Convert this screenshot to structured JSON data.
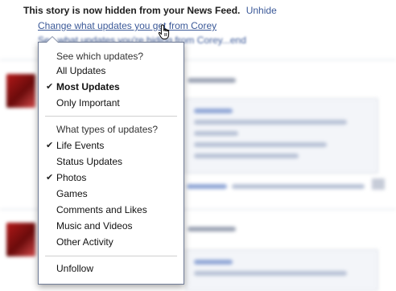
{
  "notice": {
    "text": "This story is now hidden from your News Feed.",
    "unhide_label": "Unhide"
  },
  "change_link": "Change what updates you get from Corey",
  "hidden_link": "See what updates you're hiding from Corey...end",
  "menu": {
    "section1_heading": "See which updates?",
    "section1_items": [
      {
        "label": "All Updates",
        "checked": false
      },
      {
        "label": "Most Updates",
        "checked": true
      },
      {
        "label": "Only Important",
        "checked": false
      }
    ],
    "section2_heading": "What types of updates?",
    "section2_items": [
      {
        "label": "Life Events",
        "checked": true
      },
      {
        "label": "Status Updates",
        "checked": false
      },
      {
        "label": "Photos",
        "checked": true
      },
      {
        "label": "Games",
        "checked": false
      },
      {
        "label": "Comments and Likes",
        "checked": false
      },
      {
        "label": "Music and Videos",
        "checked": false
      },
      {
        "label": "Other Activity",
        "checked": false
      }
    ],
    "unfollow_label": "Unfollow"
  },
  "colors": {
    "link": "#3b5998",
    "menu_border": "#6f7b96"
  },
  "icons": {
    "checkmark": "✔"
  }
}
